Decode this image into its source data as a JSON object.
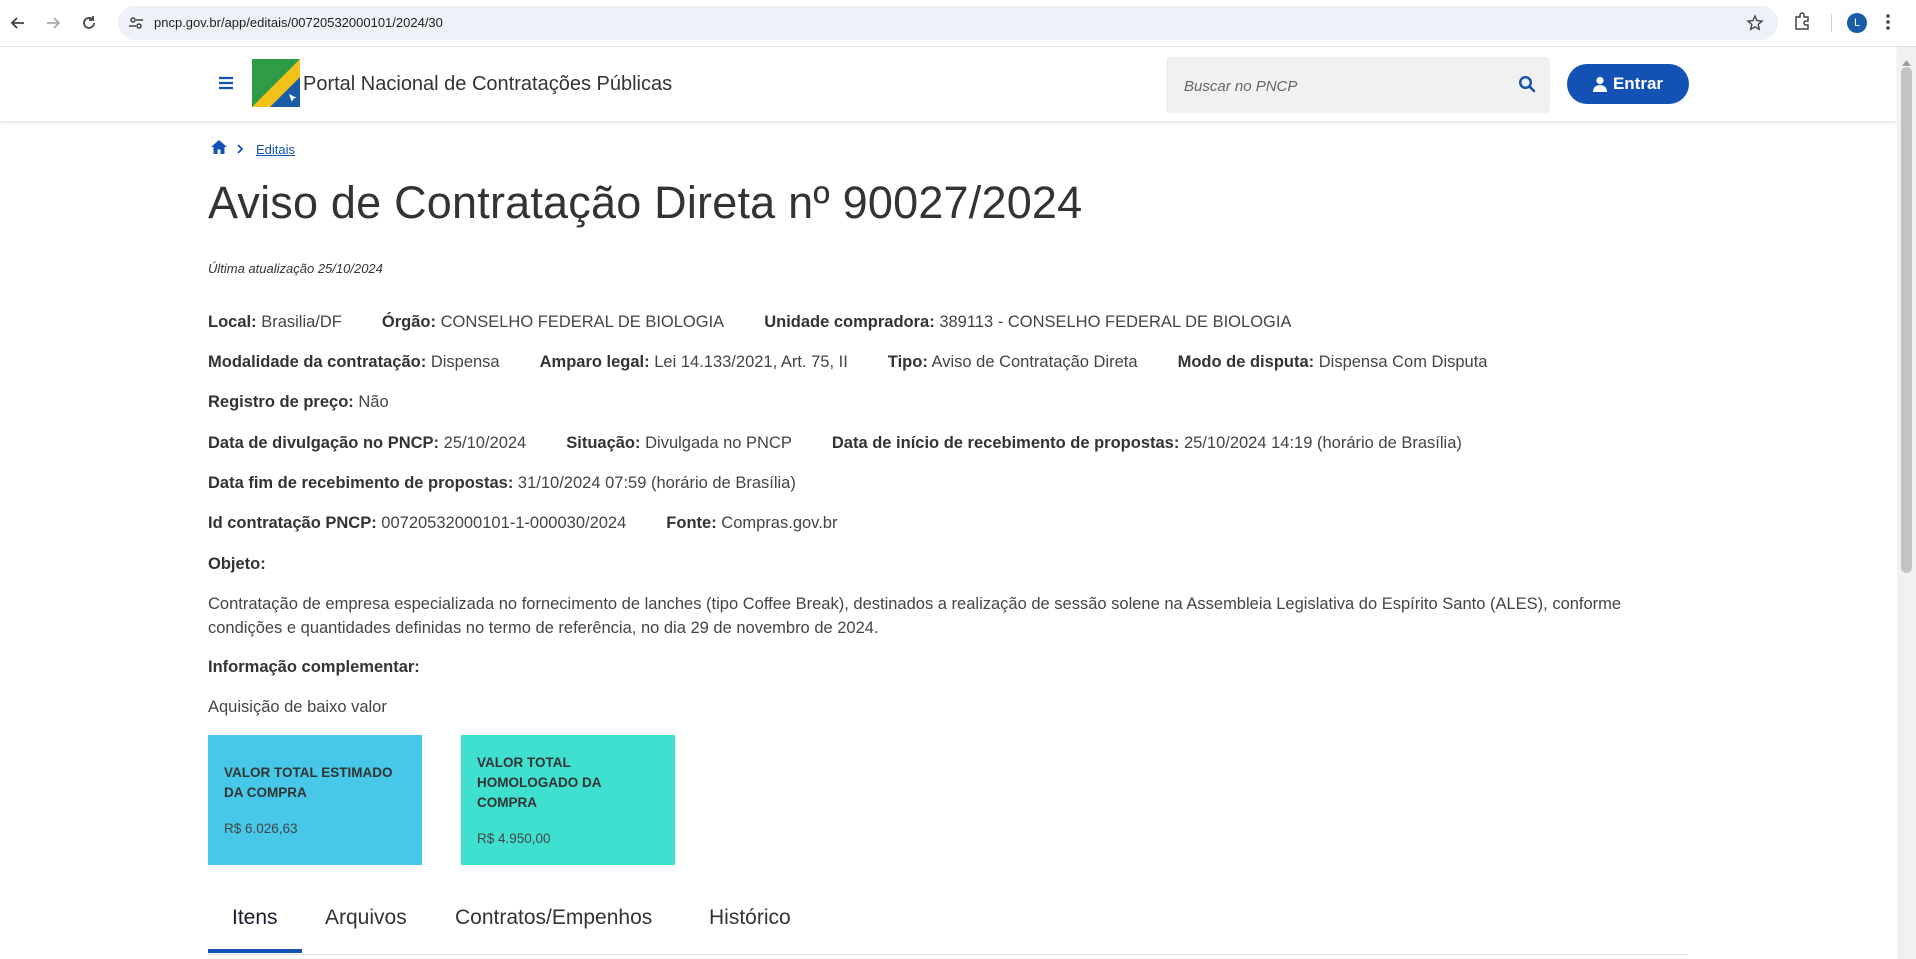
{
  "browser": {
    "url": "pncp.gov.br/app/editais/00720532000101/2024/30",
    "profile_initial": "L"
  },
  "header": {
    "portal_title": "Portal Nacional de Contratações Públicas",
    "search_placeholder": "Buscar no PNCP",
    "enter_label": "Entrar",
    "colors": {
      "primary": "#1351b4"
    }
  },
  "breadcrumb": {
    "link": "Editais"
  },
  "page": {
    "title": "Aviso de Contratação Direta nº 90027/2024",
    "last_update": "Última atualização 25/10/2024"
  },
  "fields": {
    "local": {
      "label": "Local:",
      "value": "Brasilia/DF"
    },
    "orgao": {
      "label": "Órgão:",
      "value": "CONSELHO FEDERAL DE BIOLOGIA"
    },
    "unidade": {
      "label": "Unidade compradora:",
      "value": "389113 - CONSELHO FEDERAL DE BIOLOGIA"
    },
    "modalidade": {
      "label": "Modalidade da contratação:",
      "value": "Dispensa"
    },
    "amparo": {
      "label": "Amparo legal:",
      "value": "Lei 14.133/2021, Art. 75, II"
    },
    "tipo": {
      "label": "Tipo:",
      "value": "Aviso de Contratação Direta"
    },
    "modo": {
      "label": "Modo de disputa:",
      "value": "Dispensa Com Disputa"
    },
    "registro": {
      "label": "Registro de preço:",
      "value": "Não"
    },
    "divulgacao": {
      "label": "Data de divulgação no PNCP:",
      "value": "25/10/2024"
    },
    "situacao": {
      "label": "Situação:",
      "value": "Divulgada no PNCP"
    },
    "inicio": {
      "label": "Data de início de recebimento de propostas:",
      "value": "25/10/2024 14:19 (horário de Brasília)"
    },
    "fim": {
      "label": "Data fim de recebimento de propostas:",
      "value": "31/10/2024 07:59 (horário de Brasília)"
    },
    "id": {
      "label": "Id contratação PNCP:",
      "value": "00720532000101-1-000030/2024"
    },
    "fonte": {
      "label": "Fonte:",
      "value": "Compras.gov.br"
    }
  },
  "objeto": {
    "label": "Objeto:",
    "text": "Contratação de empresa especializada no fornecimento de lanches (tipo Coffee Break), destinados a realização de sessão solene na Assembleia Legislativa do Espírito Santo (ALES), conforme condições e quantidades definidas no termo de referência, no dia 29 de novembro de 2024."
  },
  "info": {
    "label": "Informação complementar:",
    "text": "Aquisição de baixo valor"
  },
  "cards": {
    "estimado": {
      "label": "VALOR TOTAL ESTIMADO DA COMPRA",
      "value": "R$ 6.026,63",
      "color": "#47c8e8"
    },
    "homologado": {
      "label": "VALOR TOTAL HOMOLOGADO DA COMPRA",
      "value": "R$ 4.950,00",
      "color": "#40e0d0"
    }
  },
  "tabs": [
    "Itens",
    "Arquivos",
    "Contratos/Empenhos",
    "Histórico"
  ]
}
